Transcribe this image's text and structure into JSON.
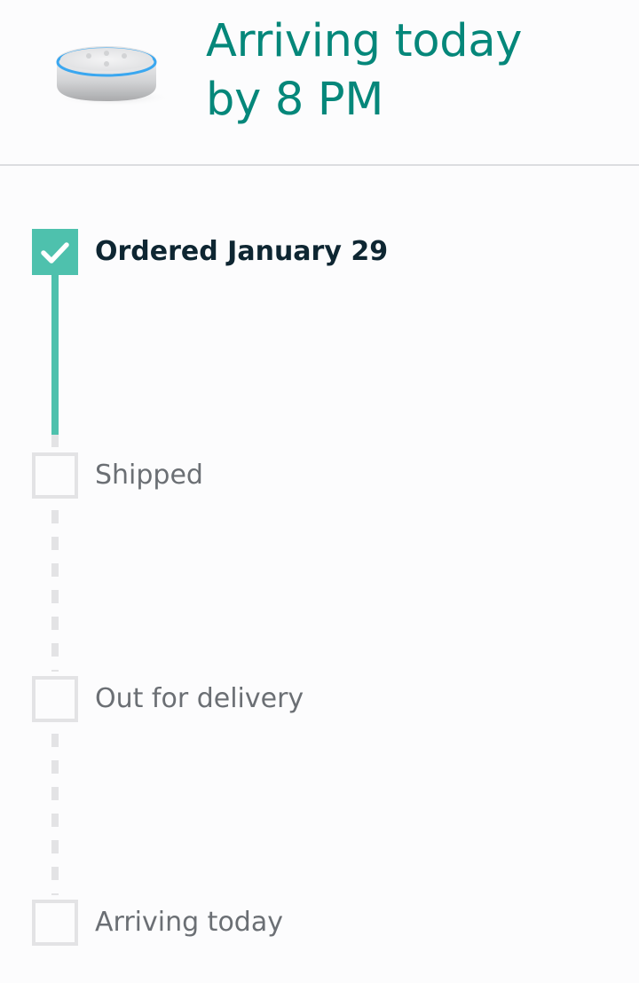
{
  "header": {
    "image": "smart-speaker-product-image",
    "headline_line1": "Arriving today",
    "headline_line2": "by 8 PM"
  },
  "colors": {
    "accent_teal": "#05877a",
    "progress_teal": "#4ec1ad",
    "pending_gray": "#e3e3e5",
    "done_text": "#0e2632",
    "pending_text": "#6b6f74"
  },
  "tracker": {
    "steps": [
      {
        "label": "Ordered January 29",
        "status": "done",
        "icon": "check-icon"
      },
      {
        "label": "Shipped",
        "status": "pending",
        "icon": "empty-checkbox-icon"
      },
      {
        "label": "Out for delivery",
        "status": "pending",
        "icon": "empty-checkbox-icon"
      },
      {
        "label": "Arriving today",
        "status": "pending",
        "icon": "empty-checkbox-icon"
      }
    ]
  }
}
